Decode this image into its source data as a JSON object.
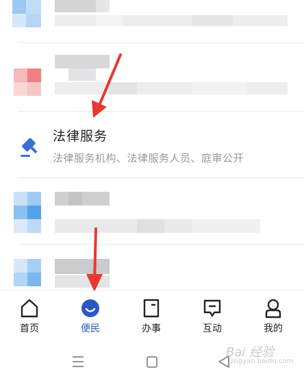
{
  "legal_service": {
    "title": "法律服务",
    "subtitle": "法律服务机构、法律服务人员、庭审公开"
  },
  "tabs": [
    {
      "label": "首页",
      "icon": "home-icon"
    },
    {
      "label": "便民",
      "icon": "smile-icon",
      "active": true
    },
    {
      "label": "办事",
      "icon": "document-icon"
    },
    {
      "label": "互动",
      "icon": "chat-icon"
    },
    {
      "label": "我的",
      "icon": "user-icon"
    }
  ],
  "colors": {
    "accent": "#2b59c3",
    "arrow": "#e8382f"
  },
  "watermark": {
    "brand": "Bai 经验",
    "sub": "jingyan.baidu.com"
  }
}
